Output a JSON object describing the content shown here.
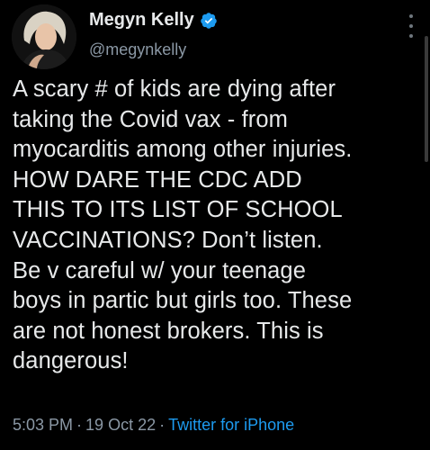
{
  "author": {
    "display_name": "Megyn Kelly",
    "handle": "@megynkelly",
    "verified": true,
    "verified_color": "#1d9bf0"
  },
  "tweet": {
    "text": "A scary # of kids are dying after\ntaking the Covid vax - from\nmyocarditis among other injuries.\nHOW DARE THE CDC ADD\nTHIS TO ITS LIST OF SCHOOL\nVACCINATIONS? Don’t listen.\nBe v careful w/ your teenage\nboys in partic but girls too. These\nare not honest brokers. This is\ndangerous!"
  },
  "meta": {
    "time": "5:03 PM",
    "separator": "·",
    "date": "19 Oct 22",
    "source": "Twitter for iPhone"
  },
  "icons": {
    "verified": "verified-badge-icon",
    "more": "more-options-icon"
  },
  "colors": {
    "background": "#000000",
    "primary_text": "#e7e9ea",
    "secondary_text": "#8b98a5",
    "link": "#1d9bf0"
  }
}
